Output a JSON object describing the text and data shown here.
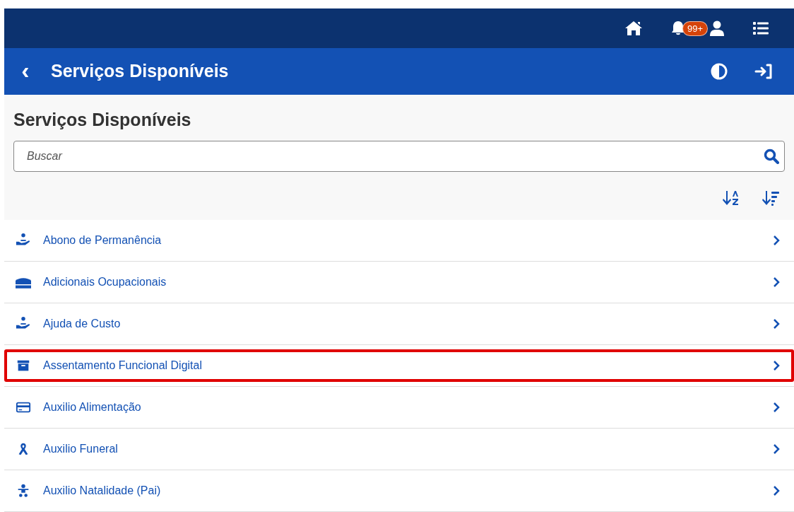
{
  "top_bar": {
    "notification_badge": "99+"
  },
  "header": {
    "back": "‹",
    "title": "Serviços Disponíveis"
  },
  "page_title": "Serviços Disponíveis",
  "search": {
    "placeholder": "Buscar"
  },
  "services": [
    {
      "label": "Abono de Permanência",
      "highlighted": false
    },
    {
      "label": "Adicionais Ocupacionais",
      "highlighted": false
    },
    {
      "label": "Ajuda de Custo",
      "highlighted": false
    },
    {
      "label": "Assentamento Funcional Digital",
      "highlighted": true
    },
    {
      "label": "Auxilio Alimentação",
      "highlighted": false
    },
    {
      "label": "Auxilio Funeral",
      "highlighted": false
    },
    {
      "label": "Auxilio Natalidade (Pai)",
      "highlighted": false
    }
  ]
}
